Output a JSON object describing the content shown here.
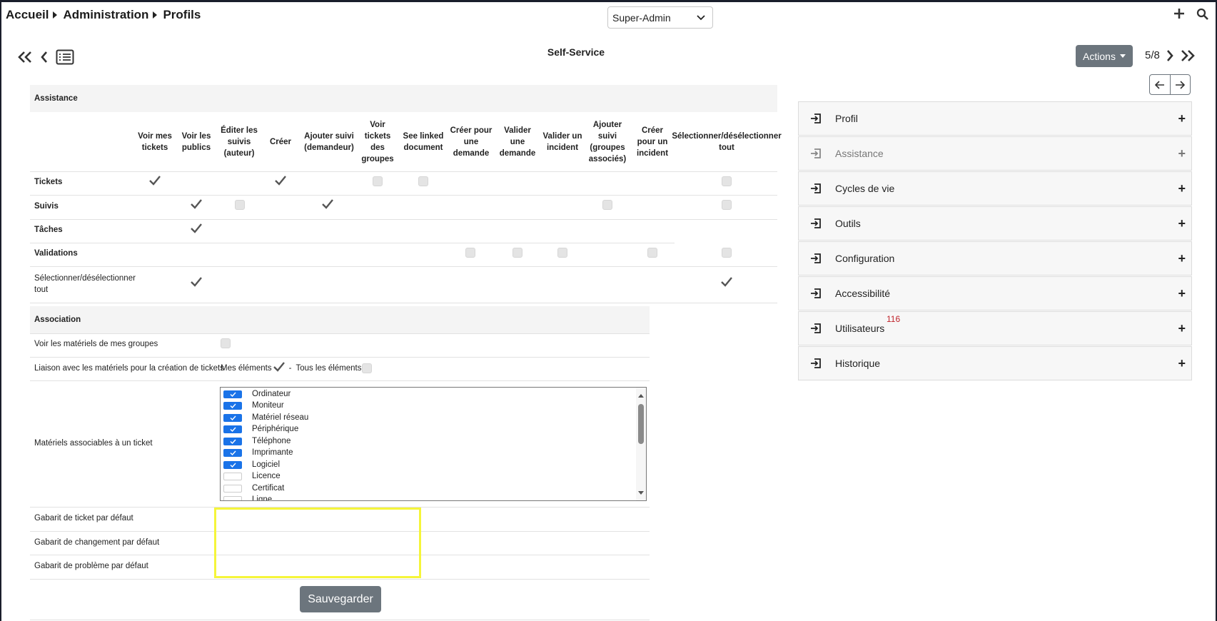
{
  "breadcrumb": [
    "Accueil",
    "Administration",
    "Profils"
  ],
  "profile_select": {
    "value": "Super-Admin"
  },
  "page_title": "Self-Service",
  "actions_label": "Actions",
  "pager": "5/8",
  "assistance": {
    "section_title": "Assistance",
    "columns": [
      "Voir mes tickets",
      "Voir les publics",
      "Éditer les suivis (auteur)",
      "Créer",
      "Ajouter suivi (demandeur)",
      "Voir tickets des groupes",
      "See linked document",
      "Créer pour une demande",
      "Valider une demande",
      "Valider un incident",
      "Ajouter suivi (groupes associés)",
      "Créer pour un incident",
      "Sélectionner/désélectionner tout"
    ],
    "rows": [
      {
        "label": "Tickets"
      },
      {
        "label": "Suivis"
      },
      {
        "label": "Tâches"
      },
      {
        "label": "Validations"
      },
      {
        "label": "Sélectionner/désélectionner tout"
      }
    ]
  },
  "association": {
    "section_title": "Association",
    "rows": {
      "voir_materiels": "Voir les matériels de mes groupes",
      "liaison": "Liaison avec les matériels pour la création de tickets",
      "mes_elements": "Mes éléments",
      "dash": "-",
      "tous_elements": "Tous les éléments",
      "materiels_associables": "Matériels associables à un ticket",
      "gabarit_ticket": "Gabarit de ticket par défaut",
      "gabarit_changement": "Gabarit de changement par défaut",
      "gabarit_probleme": "Gabarit de problème par défaut"
    },
    "list_items": [
      {
        "label": "Ordinateur",
        "checked": true
      },
      {
        "label": "Moniteur",
        "checked": true
      },
      {
        "label": "Matériel réseau",
        "checked": true
      },
      {
        "label": "Périphérique",
        "checked": true
      },
      {
        "label": "Téléphone",
        "checked": true
      },
      {
        "label": "Imprimante",
        "checked": true
      },
      {
        "label": "Logiciel",
        "checked": true
      },
      {
        "label": "Licence",
        "checked": false
      },
      {
        "label": "Certificat",
        "checked": false
      },
      {
        "label": "Ligne",
        "checked": false
      }
    ]
  },
  "save_label": "Sauvegarder",
  "side_panel": [
    {
      "label": "Profil"
    },
    {
      "label": "Assistance"
    },
    {
      "label": "Cycles de vie"
    },
    {
      "label": "Outils"
    },
    {
      "label": "Configuration"
    },
    {
      "label": "Accessibilité"
    },
    {
      "label": "Utilisateurs",
      "badge": "116"
    },
    {
      "label": "Historique"
    }
  ],
  "colors": {
    "accent_blue": "#1a73e8",
    "button_grey": "#6c757d",
    "highlight_yellow": "#f5f53a",
    "badge_red": "#c0262d"
  },
  "icons": [
    "caret-right-icon",
    "chevron-down-icon",
    "plus-icon",
    "search-icon",
    "double-chevron-left-icon",
    "chevron-left-icon",
    "list-icon",
    "chevron-right-icon",
    "double-chevron-right-icon",
    "arrow-left-icon",
    "arrow-right-icon",
    "check-icon",
    "enter-icon"
  ]
}
